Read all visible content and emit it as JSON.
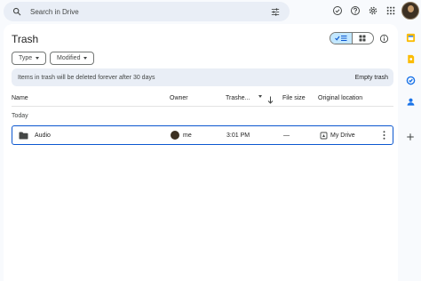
{
  "search": {
    "placeholder": "Search in Drive"
  },
  "page": {
    "title": "Trash"
  },
  "filters": [
    {
      "label": "Type"
    },
    {
      "label": "Modified"
    }
  ],
  "banner": {
    "message": "Items in trash will be deleted forever after 30 days",
    "action": "Empty trash"
  },
  "table": {
    "columns": {
      "name": "Name",
      "owner": "Owner",
      "trashed": "Trashe...",
      "file_size": "File size",
      "original_location": "Original location"
    },
    "group": "Today",
    "rows": [
      {
        "name": "Audio",
        "owner": "me",
        "trashed": "3:01 PM",
        "file_size": "—",
        "original_location": "My Drive"
      }
    ]
  },
  "icons": {
    "search": "search-icon",
    "filter": "search-options-icon",
    "offline": "offline-status-icon",
    "help": "help-icon",
    "settings": "settings-gear-icon",
    "apps": "apps-grid-icon",
    "list_view": "list-view-icon",
    "grid_view": "grid-view-icon",
    "info": "info-icon",
    "folder": "folder-icon",
    "my_drive": "my-drive-icon",
    "more": "more-vert-icon"
  },
  "colors": {
    "accent": "#0b57d0",
    "selected_toggle": "#c2e7ff",
    "search_bg": "#e9eef6",
    "calendar": "#fbbc04",
    "tasks": "#1a73e8",
    "contacts": "#1a73e8"
  }
}
